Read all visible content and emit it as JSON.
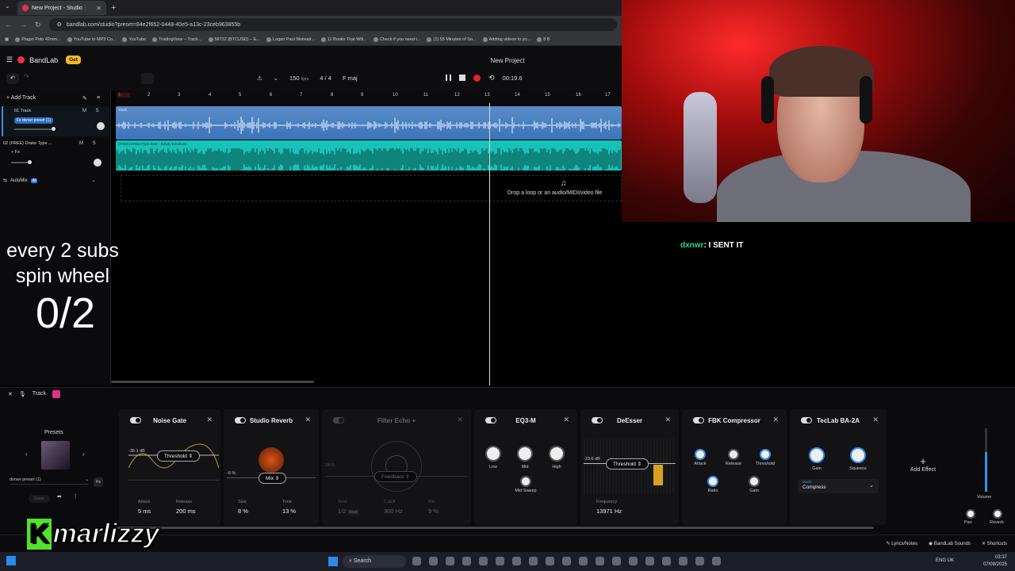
{
  "browser": {
    "tab_title": "New Project - Studio",
    "url": "bandlab.com/studio?preset=84e2f652-0448-40e5-a13c-23ceb963855b",
    "bookmarks": [
      "Piaget Polo 42mm...",
      "YouTube to MP3 Co...",
      "YouTube",
      "TradingView – Track...",
      "58722 (BTCUSD) – E...",
      "Logan Paul Motivati...",
      "11 Books That Will...",
      "Check if you need t...",
      "(1) 55 Minutes of So...",
      "Adding videos to yo...",
      "8 B"
    ]
  },
  "app": {
    "brand": "BandLab",
    "get_label": "Get",
    "project_title": "New Project",
    "tempo": "150",
    "tempo_unit": "bpm",
    "time_sig": "4 / 4",
    "key": "F maj",
    "time": "00:19.6"
  },
  "tracks_panel": {
    "add_track": "Add Track",
    "track1_name": "01 Track",
    "track1_preset": "Fx dxnwr preset (1)",
    "track2_name": "02 (FREE) Drake Type ...",
    "track2_fx": "+ Fx",
    "ms": "M S",
    "automix": "AutoMix",
    "ai": "AI"
  },
  "ruler": [
    "1",
    "2",
    "3",
    "4",
    "5",
    "6",
    "7",
    "8",
    "9",
    "10",
    "11",
    "12",
    "13",
    "14",
    "15",
    "16",
    "17"
  ],
  "lanes": {
    "clip1": "Track",
    "clip2": "(FREE) Drake Type Beat - Empty Emotions",
    "drop_text": "Drop a loop or an audio/MIDI/video file"
  },
  "overlay": {
    "line1": "every 2 subs",
    "line2": "spin wheel",
    "counter": "0/2"
  },
  "chat": {
    "user": "dxnwr",
    "message": ": I SENT IT"
  },
  "fx_header": {
    "track": "Track"
  },
  "presets": {
    "title": "Presets",
    "selected": "dxnwr preset (1)",
    "save": "Save",
    "fx": "Fx"
  },
  "effects": {
    "noise_gate": {
      "title": "Noise Gate",
      "db": "-36.1 dB",
      "threshold": "Threshold",
      "attack_label": "Attack",
      "attack": "5 ms",
      "release_label": "Release",
      "release": "200 ms"
    },
    "reverb": {
      "title": "Studio Reverb",
      "db": "-6 %",
      "mix": "Mix",
      "size_label": "Size",
      "size": "8 %",
      "tone_label": "Tone",
      "tone": "13 %"
    },
    "echo": {
      "title": "Filter Echo +",
      "pct": "24 %",
      "feedback": "Feedback",
      "time_label": "Time",
      "time": "1/2",
      "beat": "beat",
      "cutoff_label": "Cutoff",
      "cutoff": "300 Hz",
      "mix_label": "Mix",
      "mix": "9 %"
    },
    "eq": {
      "title": "EQ3-M",
      "low": "Low",
      "mid": "Mid",
      "high": "High",
      "sweep": "Mid Sweep"
    },
    "deesser": {
      "title": "DeEsser",
      "db": "-23.6 dB",
      "threshold": "Threshold",
      "freq_label": "Frequency",
      "freq": "13971 Hz"
    },
    "compressor": {
      "title": "FBK Compressor",
      "attack": "Attack",
      "release": "Release",
      "threshold": "Threshold",
      "ratio": "Ratio",
      "gain": "Gain"
    },
    "tec": {
      "title": "TecLab BA-2A",
      "gain": "Gain",
      "squeeze": "Squeeze",
      "mode_label": "Mode",
      "mode": "Compress"
    }
  },
  "add_effect": "Add Effect",
  "volume": {
    "volume": "Volume",
    "pan": "Pan",
    "reverb": "Reverb"
  },
  "status": {
    "lyrics": "Lyrics/Notes",
    "sounds": "BandLab Sounds",
    "shortcuts": "Shortcuts"
  },
  "streamer": {
    "k": "K",
    "name": "marlizzy"
  },
  "taskbar": {
    "search": "Search",
    "time": "03:37",
    "date": "07/09/2025",
    "lang": "ENG UK"
  }
}
